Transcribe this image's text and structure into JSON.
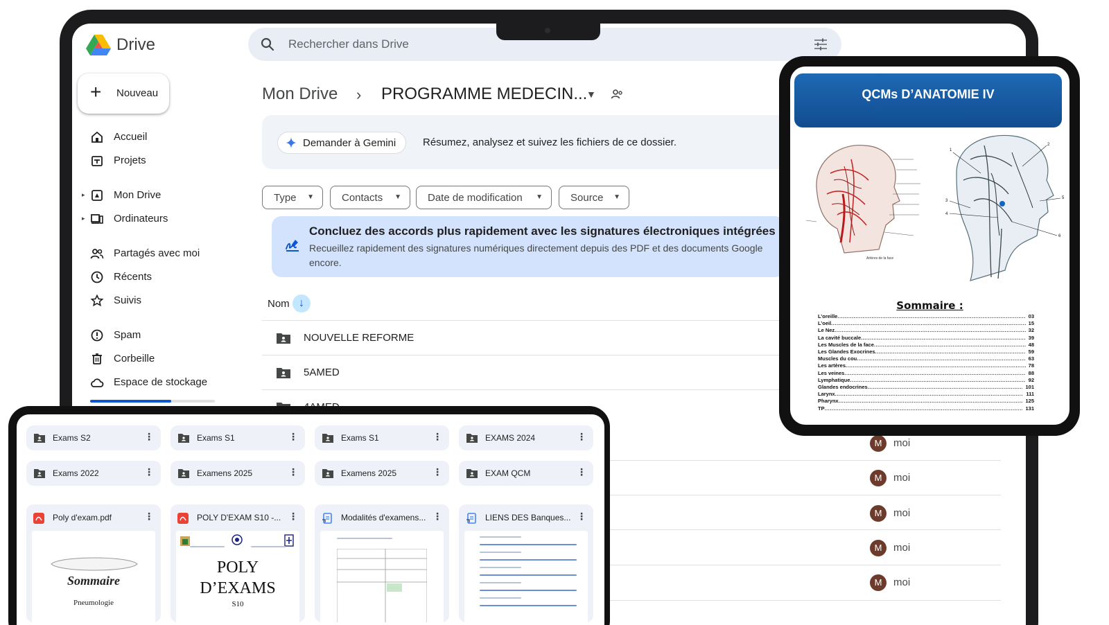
{
  "drive": {
    "app_title": "Drive",
    "search_placeholder": "Rechercher dans Drive",
    "new_button": "Nouveau",
    "nav": [
      {
        "label": "Accueil"
      },
      {
        "label": "Projets"
      },
      {
        "label": "Mon Drive"
      },
      {
        "label": "Ordinateurs"
      },
      {
        "label": "Partagés avec moi"
      },
      {
        "label": "Récents"
      },
      {
        "label": "Suivis"
      },
      {
        "label": "Spam"
      },
      {
        "label": "Corbeille"
      },
      {
        "label": "Espace de stockage"
      }
    ],
    "storage_used_fraction": 0.65,
    "breadcrumb": {
      "root": "Mon Drive",
      "separator": "›",
      "current": "PROGRAMME MEDECIN..."
    },
    "gemini": {
      "button": "Demander à Gemini",
      "text": "Résumez, analysez et suivez les fichiers de ce dossier."
    },
    "filters": [
      "Type",
      "Contacts",
      "Date de modification",
      "Source"
    ],
    "promo": {
      "title": "Concluez des accords plus rapidement avec les signatures électroniques intégrées",
      "body": "Recueillez rapidement des signatures numériques directement depuis des PDF et des documents Google encore."
    },
    "sort": {
      "label": "Nom"
    },
    "rows": [
      {
        "name": "NOUVELLE REFORME"
      },
      {
        "name": "5AMED"
      },
      {
        "name": "4AMED"
      }
    ],
    "owners": [
      "moi",
      "moi",
      "moi",
      "moi",
      "moi"
    ],
    "owner_avatar": "M"
  },
  "tablet": {
    "title": "QCMs D’ANATOMIE IV",
    "sommaire_title": "Sommaire :",
    "toc": [
      {
        "name": "L’oreille",
        "page": "03"
      },
      {
        "name": "L’oeil",
        "page": "15"
      },
      {
        "name": "Le Nez",
        "page": "32"
      },
      {
        "name": "La cavité buccale",
        "page": "39"
      },
      {
        "name": "Les Muscles de la face",
        "page": "48"
      },
      {
        "name": "Les Glandes Exocrines",
        "page": "59"
      },
      {
        "name": "Muscles du cou",
        "page": "63"
      },
      {
        "name": "Les artères",
        "page": "78"
      },
      {
        "name": "Les veines",
        "page": "88"
      },
      {
        "name": "Lymphatique",
        "page": "92"
      },
      {
        "name": "Glandes endocrines",
        "page": "101"
      },
      {
        "name": "Larynx",
        "page": "111"
      },
      {
        "name": "Pharynx",
        "page": "125"
      },
      {
        "name": "TP",
        "page": "131"
      }
    ],
    "figure_labels": [
      "Artères de la face",
      "1",
      "2",
      "3",
      "4",
      "5",
      "6"
    ]
  },
  "mobile": {
    "folders": [
      {
        "name": "Exams S2"
      },
      {
        "name": "Exams S1"
      },
      {
        "name": "Exams S1"
      },
      {
        "name": "EXAMS 2024"
      },
      {
        "name": "Exams 2022"
      },
      {
        "name": "Examens 2025"
      },
      {
        "name": "Examens 2025"
      },
      {
        "name": "EXAM QCM"
      }
    ],
    "files": [
      {
        "name": "Poly d'exam.pdf",
        "icon_color": "#ea4335",
        "type": "pdf"
      },
      {
        "name": "POLY D'EXAM S10 -...",
        "icon_color": "#ea4335",
        "type": "pdf"
      },
      {
        "name": "Modalités d'examens...",
        "icon_color": "#4285f4",
        "type": "shortcut-doc"
      },
      {
        "name": "LIENS DES Banques...",
        "icon_color": "#4285f4",
        "type": "shortcut-doc"
      }
    ],
    "thumb_poly": {
      "line1": "POLY",
      "line2": "D’EXAMS",
      "line3": "S10"
    },
    "thumb_sommaire": {
      "title": "Sommaire",
      "subtitle": "Pneumologie"
    }
  },
  "colors": {
    "accent": "#0b57d0",
    "search_bg": "#e9eef6",
    "promo_bg": "#d3e3fd",
    "tablet_header": "#1e68b4",
    "avatar": "#6d3b2c"
  }
}
